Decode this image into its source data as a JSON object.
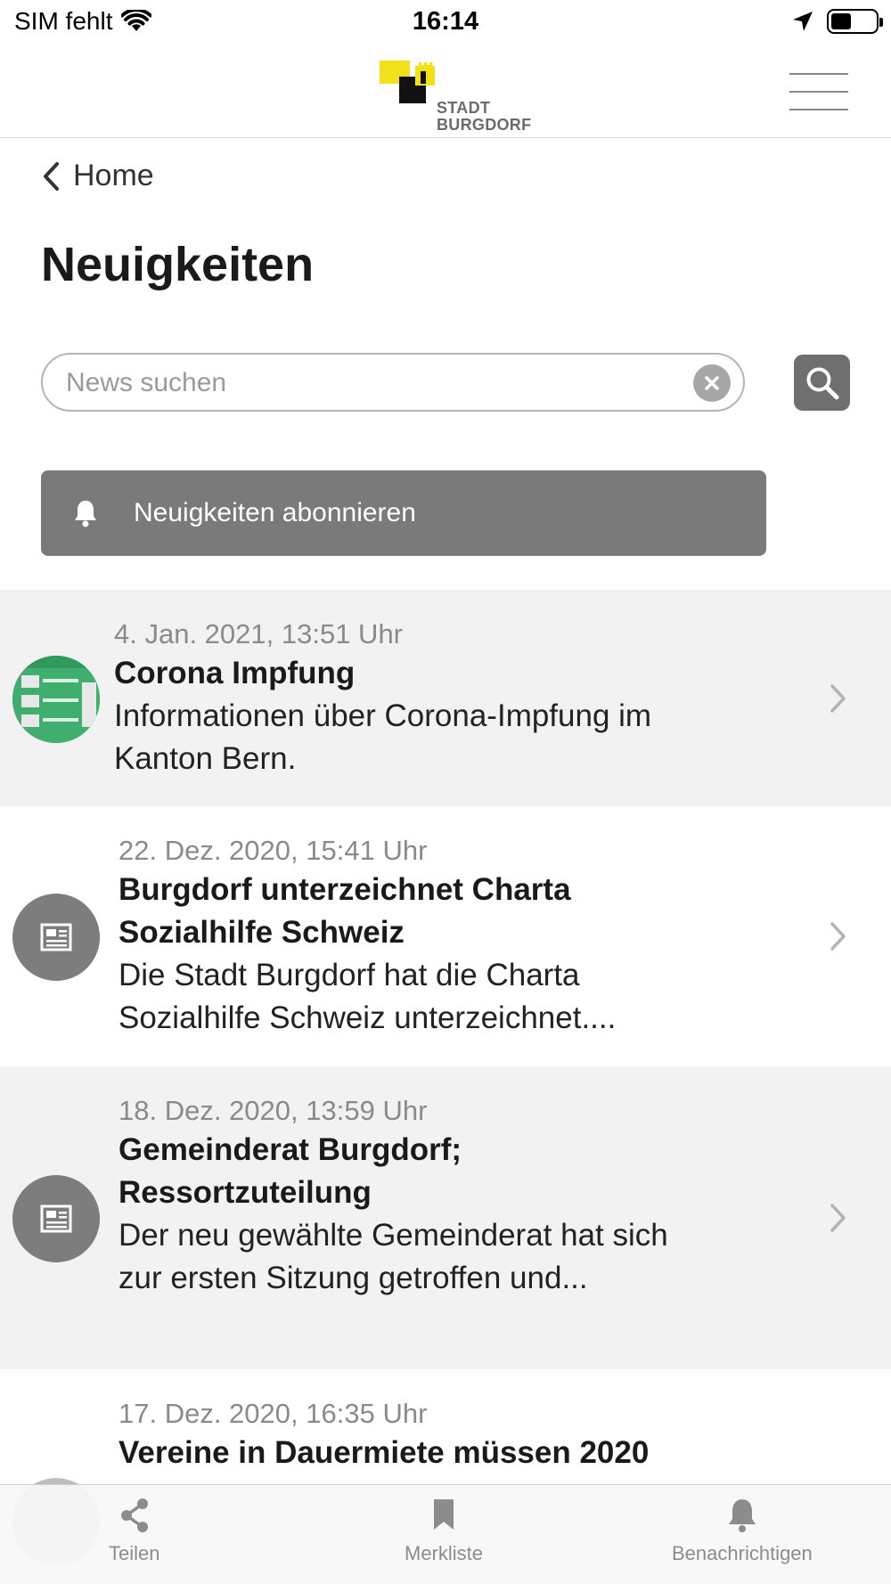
{
  "status_bar": {
    "carrier": "SIM fehlt",
    "time": "16:14"
  },
  "header": {
    "logo_text_line1": "STADT",
    "logo_text_line2": "BURGDORF",
    "menu_icon": "hamburger-menu-icon"
  },
  "nav": {
    "back_label": "Home"
  },
  "page": {
    "title": "Neuigkeiten"
  },
  "search": {
    "placeholder": "News suchen",
    "value": ""
  },
  "subscribe": {
    "label": "Neuigkeiten abonnieren"
  },
  "news": [
    {
      "date": "4. Jan. 2021, 13:51 Uhr",
      "title": "Corona Impfung",
      "desc": "Informationen über Corona-Impfung im Kanton Bern.",
      "thumb": "image"
    },
    {
      "date": "22. Dez. 2020, 15:41 Uhr",
      "title": "Burgdorf unterzeichnet Charta Sozialhilfe Schweiz",
      "desc": "Die Stadt Burgdorf hat die Charta Sozialhilfe Schweiz unterzeichnet....",
      "thumb": "newspaper-icon"
    },
    {
      "date": "18. Dez. 2020, 13:59 Uhr",
      "title": "Gemeinderat Burgdorf; Ressortzuteilung",
      "desc": "Der neu gewählte Gemeinderat hat sich zur ersten Sitzung getroffen und...",
      "thumb": "newspaper-icon"
    },
    {
      "date": "17. Dez. 2020, 16:35 Uhr",
      "title": "Vereine in Dauermiete müssen 2020",
      "thumb": "newspaper-icon"
    }
  ],
  "tabbar": {
    "share_label": "Teilen",
    "bookmark_label": "Merkliste",
    "notify_label": "Benachrichtigen"
  },
  "colors": {
    "accent_grey": "#7a7a7a",
    "logo_yellow": "#f2e01b",
    "thumb_green": "#3fae6e"
  }
}
